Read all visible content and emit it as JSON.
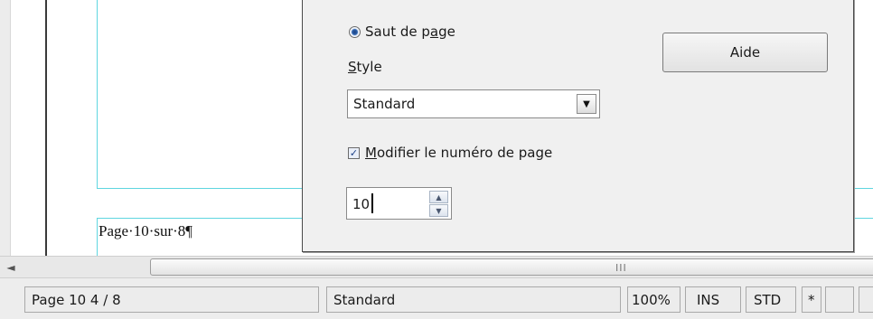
{
  "document": {
    "footer_text": "Page·10·sur·8¶"
  },
  "dialog": {
    "radio_label_pre": "Saut de p",
    "radio_label_mnemonic": "a",
    "radio_label_post": "ge",
    "style_label_mnemonic": "S",
    "style_label_post": "tyle",
    "style_value": "Standard",
    "dropdown_glyph": "▼",
    "checkbox_mark": "✓",
    "checkbox_label_mnemonic": "M",
    "checkbox_label_post": "odifier le numéro de page",
    "page_number_value": "10",
    "spin_up_glyph": "▲",
    "spin_down_glyph": "▼",
    "help_button_label": "Aide"
  },
  "scrollbar": {
    "left_arrow": "◄",
    "grip": "III"
  },
  "statusbar": {
    "page_info": "Page 10   4 / 8",
    "page_style": "Standard",
    "zoom": "100%",
    "insert_mode": "INS",
    "selection_mode": "STD",
    "modified": "*"
  }
}
